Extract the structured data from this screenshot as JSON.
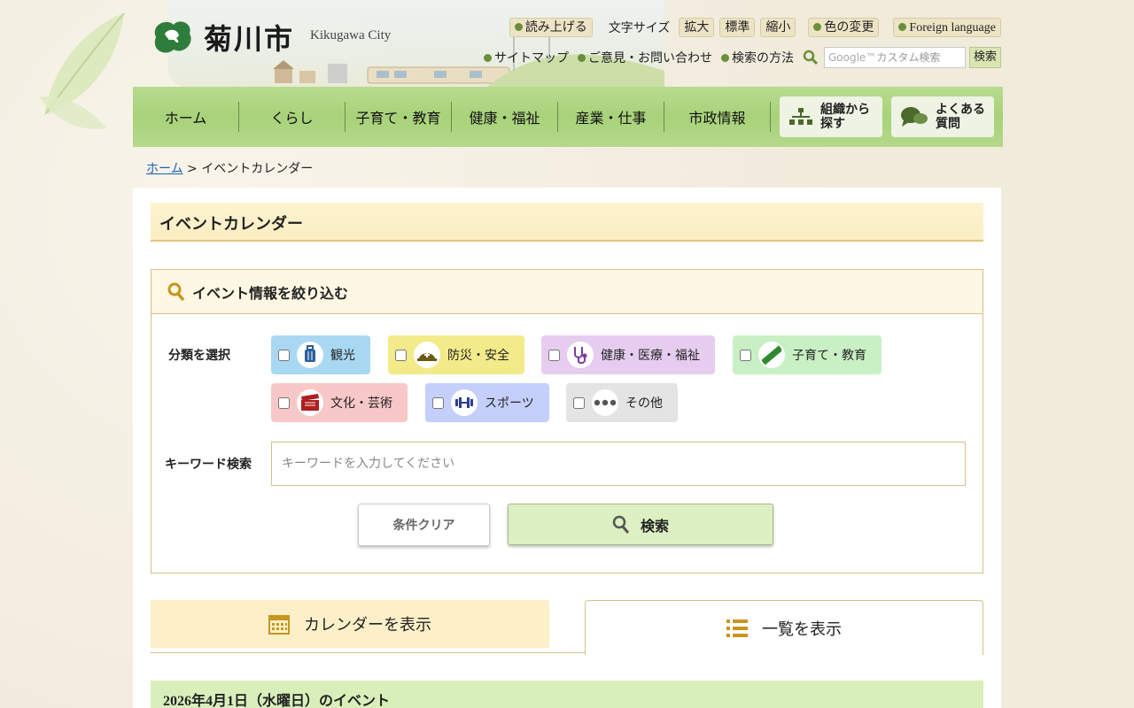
{
  "header": {
    "city_name": "菊川市",
    "city_name_en": "Kikugawa City",
    "util": {
      "read_aloud": "読み上げる",
      "text_size_label": "文字サイズ",
      "size_large": "拡大",
      "size_standard": "標準",
      "size_small": "縮小",
      "color_change": "色の変更",
      "foreign_language": "Foreign language",
      "sitemap": "サイトマップ",
      "feedback": "ご意見・お問い合わせ",
      "search_method": "検索の方法",
      "search_placeholder": "カスタム検索",
      "search_google": "Google™",
      "search_button": "検索"
    }
  },
  "nav": {
    "items": [
      "ホーム",
      "くらし",
      "子育て・教育",
      "健康・福祉",
      "産業・仕事",
      "市政情報"
    ],
    "org_search": "組織から探す",
    "org_line1": "組織から",
    "org_line2": "探す",
    "faq_line1": "よくある",
    "faq_line2": "質問"
  },
  "breadcrumb": {
    "home": "ホーム",
    "separator": ">",
    "current": "イベントカレンダー"
  },
  "page": {
    "title": "イベントカレンダー",
    "filter_title": "イベント情報を絞り込む",
    "category_label": "分類を選択",
    "categories": [
      {
        "label": "観光",
        "color": "#a9d8f2",
        "icon": "luggage-icon"
      },
      {
        "label": "防災・安全",
        "color": "#f3ea8a",
        "icon": "helmet-icon"
      },
      {
        "label": "健康・医療・福祉",
        "color": "#e6cdef",
        "icon": "stethoscope-icon"
      },
      {
        "label": "子育て・教育",
        "color": "#c8f0c4",
        "icon": "ruler-icon"
      },
      {
        "label": "文化・芸術",
        "color": "#f8c7c7",
        "icon": "clapperboard-icon"
      },
      {
        "label": "スポーツ",
        "color": "#c5cffb",
        "icon": "dumbbell-icon"
      },
      {
        "label": "その他",
        "color": "#e4e4e4",
        "icon": "more-icon"
      }
    ],
    "keyword_label": "キーワード検索",
    "keyword_placeholder": "キーワードを入力してください",
    "clear_button": "条件クリア",
    "search_button": "検索",
    "tab_calendar": "カレンダーを表示",
    "tab_list": "一覧を表示",
    "date_heading": "2026年4月1日（水曜日）のイベント"
  },
  "colors": {
    "nav_green": "#a8d27a",
    "title_bg": "#fbeec3",
    "accent_border": "#d6c089",
    "date_bar": "#d9efba",
    "link": "#1a5fb0"
  }
}
